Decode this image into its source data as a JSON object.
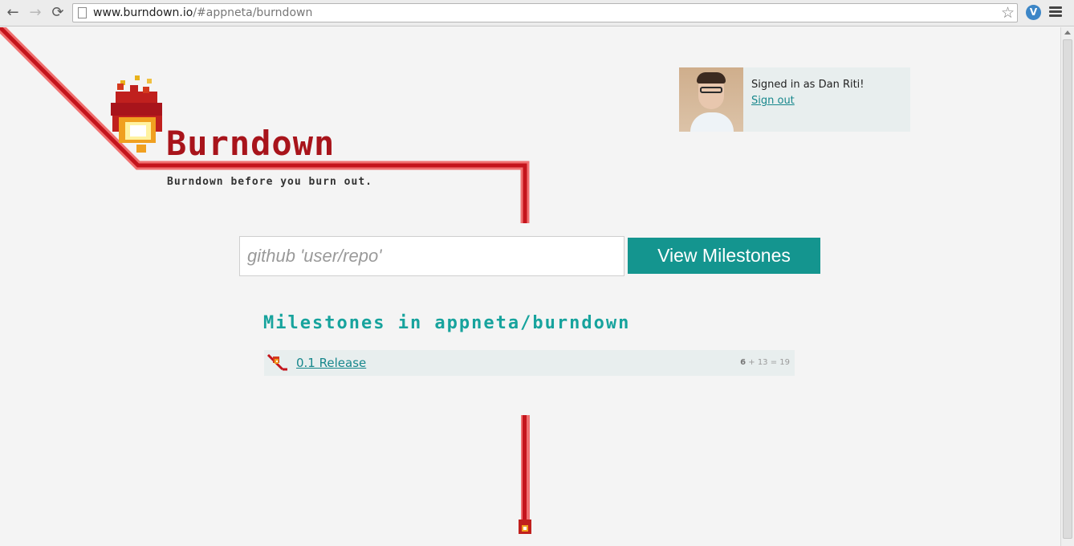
{
  "browser": {
    "url_host": "www.burndown.io",
    "url_path": "/#appneta/burndown",
    "ext_label": "V"
  },
  "header": {
    "title": "Burndown",
    "tagline": "Burndown before you burn out."
  },
  "user": {
    "signed_in_text": "Signed in as Dan Riti!",
    "sign_out_label": "Sign out"
  },
  "search": {
    "placeholder": "github 'user/repo'",
    "value": "",
    "button_label": "View Milestones"
  },
  "milestones": {
    "heading": "Milestones in appneta/burndown",
    "items": [
      {
        "title": "0.1 Release",
        "open": "6",
        "rest": " + 13 = 19"
      }
    ]
  },
  "colors": {
    "brand_red": "#a8141b",
    "accent_teal": "#14958f",
    "page_bg": "#f4f4f4"
  },
  "icons": [
    "back-icon",
    "forward-icon",
    "reload-icon",
    "page-icon",
    "star-icon",
    "extension-icon",
    "menu-icon",
    "fire-logo-icon",
    "fire-icon"
  ]
}
